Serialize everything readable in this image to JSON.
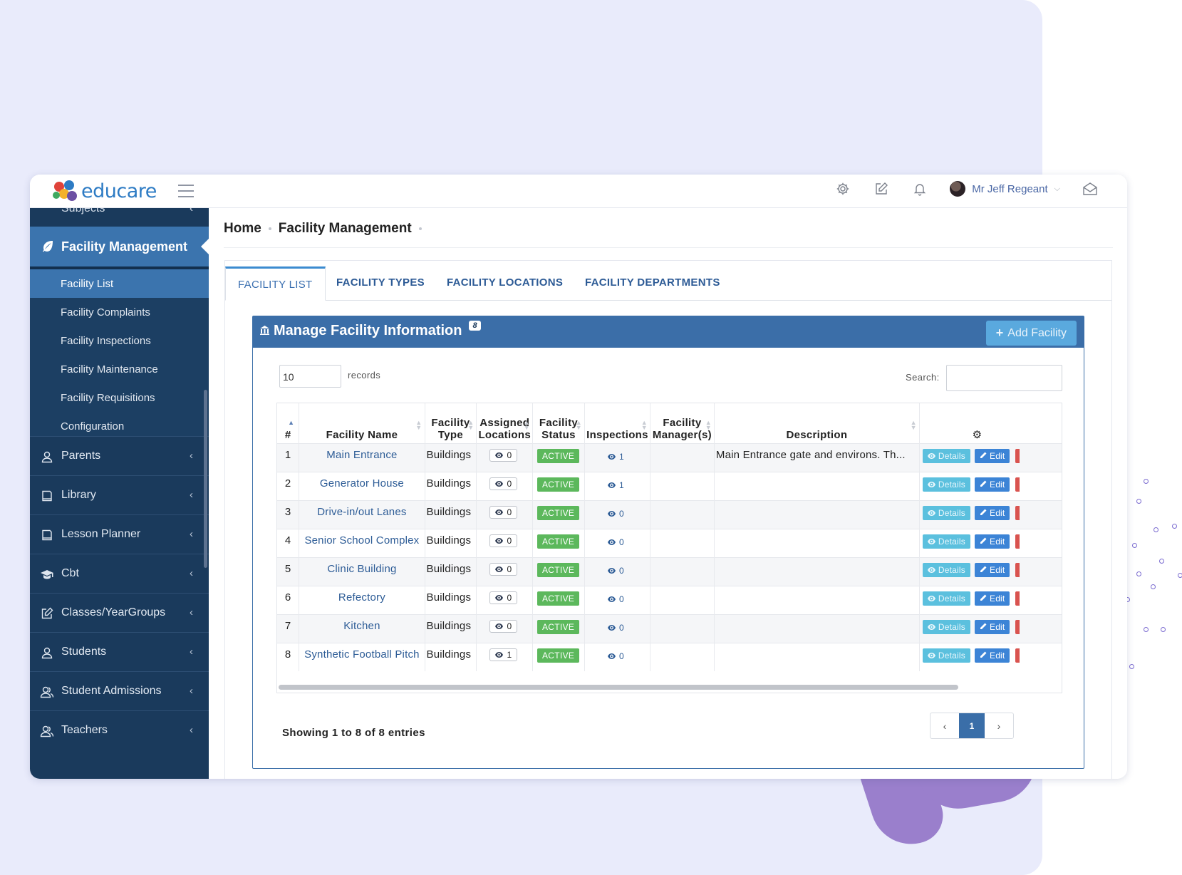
{
  "app": {
    "logo_text": "educare",
    "user_name": "Mr Jeff Regeant"
  },
  "sidebar": {
    "cutoff_item": "Subjects",
    "active_section": "Facility Management",
    "sub_items": [
      {
        "label": "Facility List",
        "active": true
      },
      {
        "label": "Facility Complaints",
        "active": false
      },
      {
        "label": "Facility Inspections",
        "active": false
      },
      {
        "label": "Facility Maintenance",
        "active": false
      },
      {
        "label": "Facility Requisitions",
        "active": false
      },
      {
        "label": "Configuration",
        "active": false
      }
    ],
    "items": [
      {
        "label": "Parents",
        "icon": "user-icon"
      },
      {
        "label": "Library",
        "icon": "book-icon"
      },
      {
        "label": "Lesson Planner",
        "icon": "book-icon"
      },
      {
        "label": "Cbt",
        "icon": "graduation-cap-icon"
      },
      {
        "label": "Classes/YearGroups",
        "icon": "edit-icon"
      },
      {
        "label": "Students",
        "icon": "user-icon"
      },
      {
        "label": "Student Admissions",
        "icon": "users-icon"
      },
      {
        "label": "Teachers",
        "icon": "users-icon"
      }
    ]
  },
  "breadcrumb": {
    "home": "Home",
    "current": "Facility Management"
  },
  "tabs": [
    {
      "label": "FACILITY LIST",
      "active": true
    },
    {
      "label": "FACILITY TYPES",
      "active": false
    },
    {
      "label": "FACILITY LOCATIONS",
      "active": false
    },
    {
      "label": "FACILITY DEPARTMENTS",
      "active": false
    }
  ],
  "panel": {
    "title": "Manage Facility Information",
    "count_badge": "8",
    "add_button": "Add Facility",
    "records_value": "10",
    "records_label": "records",
    "search_label": "Search:",
    "search_value": ""
  },
  "table": {
    "headers": {
      "num": "#",
      "name": "Facility Name",
      "type_1": "Facility",
      "type_2": "Type",
      "loc_1": "Assigned",
      "loc_2": "Locations",
      "status_1": "Facility",
      "status_2": "Status",
      "inspections": "Inspections",
      "managers_1": "Facility",
      "managers_2": "Manager(s)",
      "description": "Description"
    },
    "actions": {
      "details": "Details",
      "edit": "Edit"
    },
    "rows": [
      {
        "num": "1",
        "name": "Main Entrance",
        "type": "Buildings",
        "locations": "0",
        "status": "ACTIVE",
        "inspections": "1",
        "managers": "",
        "description": "Main Entrance gate and environs. Th..."
      },
      {
        "num": "2",
        "name": "Generator House",
        "type": "Buildings",
        "locations": "0",
        "status": "ACTIVE",
        "inspections": "1",
        "managers": "",
        "description": ""
      },
      {
        "num": "3",
        "name": "Drive-in/out Lanes",
        "type": "Buildings",
        "locations": "0",
        "status": "ACTIVE",
        "inspections": "0",
        "managers": "",
        "description": ""
      },
      {
        "num": "4",
        "name": "Senior School Complex",
        "type": "Buildings",
        "locations": "0",
        "status": "ACTIVE",
        "inspections": "0",
        "managers": "",
        "description": ""
      },
      {
        "num": "5",
        "name": "Clinic Building",
        "type": "Buildings",
        "locations": "0",
        "status": "ACTIVE",
        "inspections": "0",
        "managers": "",
        "description": ""
      },
      {
        "num": "6",
        "name": "Refectory",
        "type": "Buildings",
        "locations": "0",
        "status": "ACTIVE",
        "inspections": "0",
        "managers": "",
        "description": ""
      },
      {
        "num": "7",
        "name": "Kitchen",
        "type": "Buildings",
        "locations": "0",
        "status": "ACTIVE",
        "inspections": "0",
        "managers": "",
        "description": ""
      },
      {
        "num": "8",
        "name": "Synthetic Football Pitch",
        "type": "Buildings",
        "locations": "1",
        "status": "ACTIVE",
        "inspections": "0",
        "managers": "",
        "description": ""
      }
    ]
  },
  "footer": {
    "showing": "Showing 1 to 8 of 8 entries",
    "current_page": "1",
    "prev": "‹",
    "next": "›"
  },
  "colors": {
    "sidebar_bg": "#1a3a5c",
    "accent": "#3b74ae",
    "status_active": "#5cb85c",
    "details_btn": "#5bc0de",
    "edit_btn": "#3c84d6",
    "delete_btn": "#d9534f"
  }
}
